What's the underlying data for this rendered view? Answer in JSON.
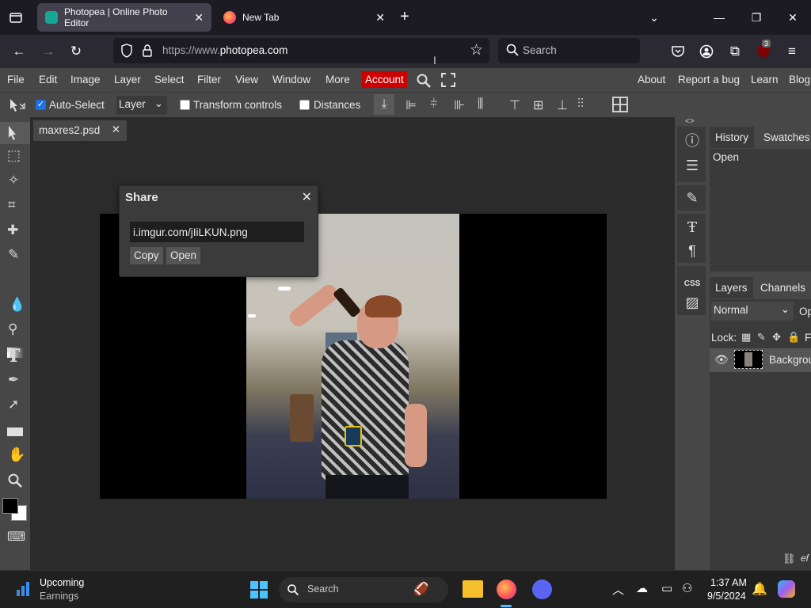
{
  "browser": {
    "tabs": [
      {
        "title": "Photopea | Online Photo Editor",
        "active": true
      },
      {
        "title": "New Tab",
        "active": false
      }
    ],
    "new_tab_symbol": "+",
    "url_prefix": "https://www.",
    "url_domain": "photopea.com",
    "search_placeholder": "Search",
    "extension_badge": "3"
  },
  "photopea": {
    "menu": [
      "File",
      "Edit",
      "Image",
      "Layer",
      "Select",
      "Filter",
      "View",
      "Window",
      "More"
    ],
    "account_label": "Account",
    "right_menu": [
      "About",
      "Report a bug",
      "Learn",
      "Blog"
    ],
    "options": {
      "auto_select_label": "Auto-Select",
      "auto_select_checked": true,
      "auto_select_mode": "Layer",
      "transform_label": "Transform controls",
      "distances_label": "Distances"
    },
    "document_tab": "maxres2.psd",
    "share_dialog": {
      "title": "Share",
      "url": "i.imgur.com/jIiLKUN.png",
      "copy_label": "Copy",
      "open_label": "Open"
    },
    "right_panel": {
      "top_tabs": [
        "History",
        "Swatches"
      ],
      "history_items": [
        "Open"
      ],
      "bottom_tabs": [
        "Layers",
        "Channels"
      ],
      "blend_mode": "Normal",
      "opacity_label": "Op",
      "lock_label": "Lock:",
      "fill_label": "F",
      "layer_name": "Backgrou",
      "footer_label": "ef"
    },
    "colors": {
      "accent_red": "#cc0000",
      "foreground": "#000000",
      "background": "#ffffff"
    }
  },
  "taskbar": {
    "widget_title": "Upcoming",
    "widget_subtitle": "Earnings",
    "search_placeholder": "Search",
    "time": "1:37 AM",
    "date": "9/5/2024"
  }
}
